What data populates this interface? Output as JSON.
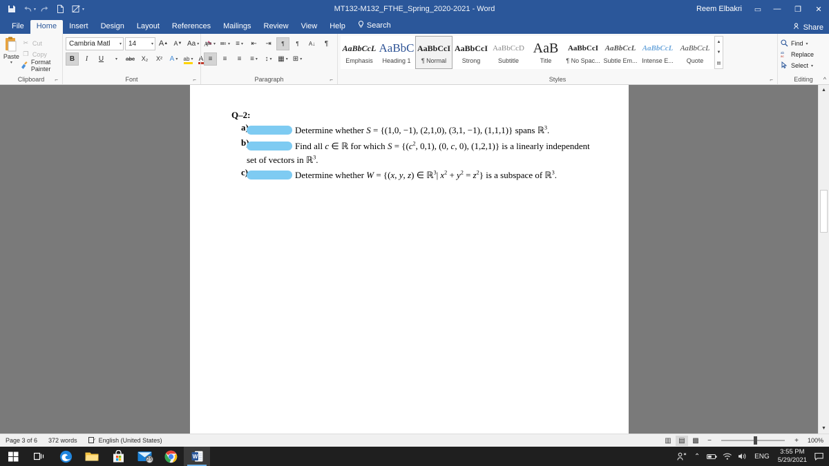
{
  "titlebar": {
    "document_title": "MT132-M132_FTHE_Spring_2020-2021  -  Word",
    "user_name": "Reem Elbakri",
    "quick_access": [
      {
        "name": "save-icon",
        "label": "Save"
      },
      {
        "name": "undo-icon",
        "label": "Undo"
      },
      {
        "name": "redo-icon",
        "label": "Redo"
      },
      {
        "name": "new-document-icon",
        "label": "New"
      },
      {
        "name": "draw-edit-icon",
        "label": "Draw"
      },
      {
        "name": "customize-qat-icon",
        "label": "Customize Quick Access Toolbar"
      }
    ],
    "ribbon_display_options": "▭",
    "minimize": "—",
    "restore": "❐",
    "close": "✕"
  },
  "tabs": [
    {
      "label": "File",
      "active": false
    },
    {
      "label": "Home",
      "active": true
    },
    {
      "label": "Insert",
      "active": false
    },
    {
      "label": "Design",
      "active": false
    },
    {
      "label": "Layout",
      "active": false
    },
    {
      "label": "References",
      "active": false
    },
    {
      "label": "Mailings",
      "active": false
    },
    {
      "label": "Review",
      "active": false
    },
    {
      "label": "View",
      "active": false
    },
    {
      "label": "Help",
      "active": false
    },
    {
      "label": "Search",
      "active": false
    }
  ],
  "share": {
    "label": "Share"
  },
  "ribbon": {
    "clipboard": {
      "group_label": "Clipboard",
      "paste_label": "Paste",
      "commands": [
        {
          "label": "Cut",
          "enabled": false
        },
        {
          "label": "Copy",
          "enabled": false
        },
        {
          "label": "Format Painter",
          "enabled": true
        }
      ]
    },
    "font": {
      "group_label": "Font",
      "font_name": "Cambria Matl",
      "font_size": "14",
      "grow_font": "A",
      "shrink_font": "A",
      "change_case": "Aa",
      "clear_formatting": "A",
      "bold": "B",
      "italic": "I",
      "underline": "U",
      "strikethrough": "abc",
      "subscript": "X₂",
      "superscript": "X²",
      "text_effects": "A",
      "highlight": "ab",
      "font_color": "A"
    },
    "paragraph": {
      "group_label": "Paragraph",
      "bullets": "≔",
      "numbering": "≕",
      "multilevel": "≡",
      "decrease_indent": "⇤",
      "increase_indent": "⇥",
      "ltr": "¶",
      "rtl": "¶",
      "sort": "A↓",
      "show_marks": "¶",
      "align_left": "≡",
      "align_center": "≡",
      "align_right": "≡",
      "justify": "≡",
      "line_spacing": "↕",
      "shading": "▦",
      "borders": "⊞"
    },
    "styles": {
      "group_label": "Styles",
      "items": [
        {
          "sample": "AaBbCcL",
          "name": "Emphasis",
          "style": "italic-serif",
          "active": false
        },
        {
          "sample": "AaBbC",
          "name": "Heading 1",
          "style": "heading1",
          "active": false
        },
        {
          "sample": "AaBbCcI",
          "name": "¶ Normal",
          "style": "normal",
          "active": true
        },
        {
          "sample": "AaBbCcI",
          "name": "Strong",
          "style": "strong",
          "active": false
        },
        {
          "sample": "AaBbCcD",
          "name": "Subtitle",
          "style": "subtitle",
          "active": false
        },
        {
          "sample": "AaB",
          "name": "Title",
          "style": "title",
          "active": false
        },
        {
          "sample": "AaBbCcI",
          "name": "¶ No Spac...",
          "style": "nospace",
          "active": false
        },
        {
          "sample": "AaBbCcL",
          "name": "Subtle Em...",
          "style": "subtle-em",
          "active": false
        },
        {
          "sample": "AaBbCcL",
          "name": "Intense E...",
          "style": "intense-em",
          "active": false
        },
        {
          "sample": "AaBbCcL",
          "name": "Quote",
          "style": "quote",
          "active": false
        }
      ],
      "scroll_up": "▲",
      "scroll_down": "▼",
      "scroll_more": "▤"
    },
    "editing": {
      "group_label": "Editing",
      "find": "Find",
      "replace": "Replace",
      "select": "Select"
    },
    "collapse_ribbon": "^"
  },
  "document": {
    "question_title": "Q–2:",
    "parts": [
      {
        "label": "a)",
        "redacted": true,
        "text_html": "Determine  whether  <i>S</i> = {(1,0, −1), (2,1,0), (3,1, −1), (1,1,1)} spans ℝ<sup>3</sup>."
      },
      {
        "label": "b)",
        "redacted": true,
        "text_html": "Find  all  <i>c</i> ∈ ℝ  for  which  <i>S</i> = {(<i>c</i><sup>2</sup>, 0,1), (0, <i>c</i>, 0), (1,2,1)} is a linearly independent set of vectors in ℝ<sup>3</sup>."
      },
      {
        "label": "c)",
        "redacted": true,
        "text_html": "Determine  whether  <i>W</i> = {(<i>x</i>, <i>y</i>, <i>z</i>) ∈ ℝ<sup>3</sup>| <i>x</i><sup>2</sup> + <i>y</i><sup>2</sup> = <i>z</i><sup>2</sup>} is a subspace of ℝ<sup>3</sup>."
      }
    ]
  },
  "statusbar": {
    "page_info": "Page 3 of 6",
    "word_count": "372 words",
    "language": "English (United States)",
    "proofing_icon": "▯",
    "views": [
      {
        "name": "read-mode",
        "glyph": "▥",
        "active": false
      },
      {
        "name": "print-layout",
        "glyph": "▤",
        "active": true
      },
      {
        "name": "web-layout",
        "glyph": "▩",
        "active": false
      }
    ],
    "zoom_out": "−",
    "zoom_in": "+",
    "zoom_level": "100%"
  },
  "taskbar": {
    "items": [
      {
        "name": "start-button",
        "glyph": "⊞",
        "badge": null,
        "active": false
      },
      {
        "name": "task-view-button",
        "glyph": "❏",
        "badge": null,
        "active": false
      },
      {
        "name": "edge-icon",
        "glyph": "e",
        "badge": null,
        "active": false
      },
      {
        "name": "file-explorer-icon",
        "glyph": "📁",
        "badge": null,
        "active": false
      },
      {
        "name": "microsoft-store-icon",
        "glyph": "🛍",
        "badge": null,
        "active": false
      },
      {
        "name": "mail-icon",
        "glyph": "✉",
        "badge": "25",
        "active": false
      },
      {
        "name": "chrome-icon",
        "glyph": "◉",
        "badge": null,
        "active": false
      },
      {
        "name": "word-icon",
        "glyph": "W",
        "badge": null,
        "active": true
      }
    ],
    "tray": {
      "people_icon": "⚇",
      "show_hidden_icon": "⌃",
      "battery_icon": "▮",
      "network_icon": "◟",
      "volume_icon": "🔊",
      "language": "ENG",
      "time": "3:55 PM",
      "date": "5/29/2021",
      "action_center": "▭"
    }
  },
  "colors": {
    "word_blue": "#2b579a",
    "redaction_blue": "#7ecbf2",
    "ribbon_bg": "#f8f8f8",
    "doc_backdrop": "#7a7a7a"
  }
}
